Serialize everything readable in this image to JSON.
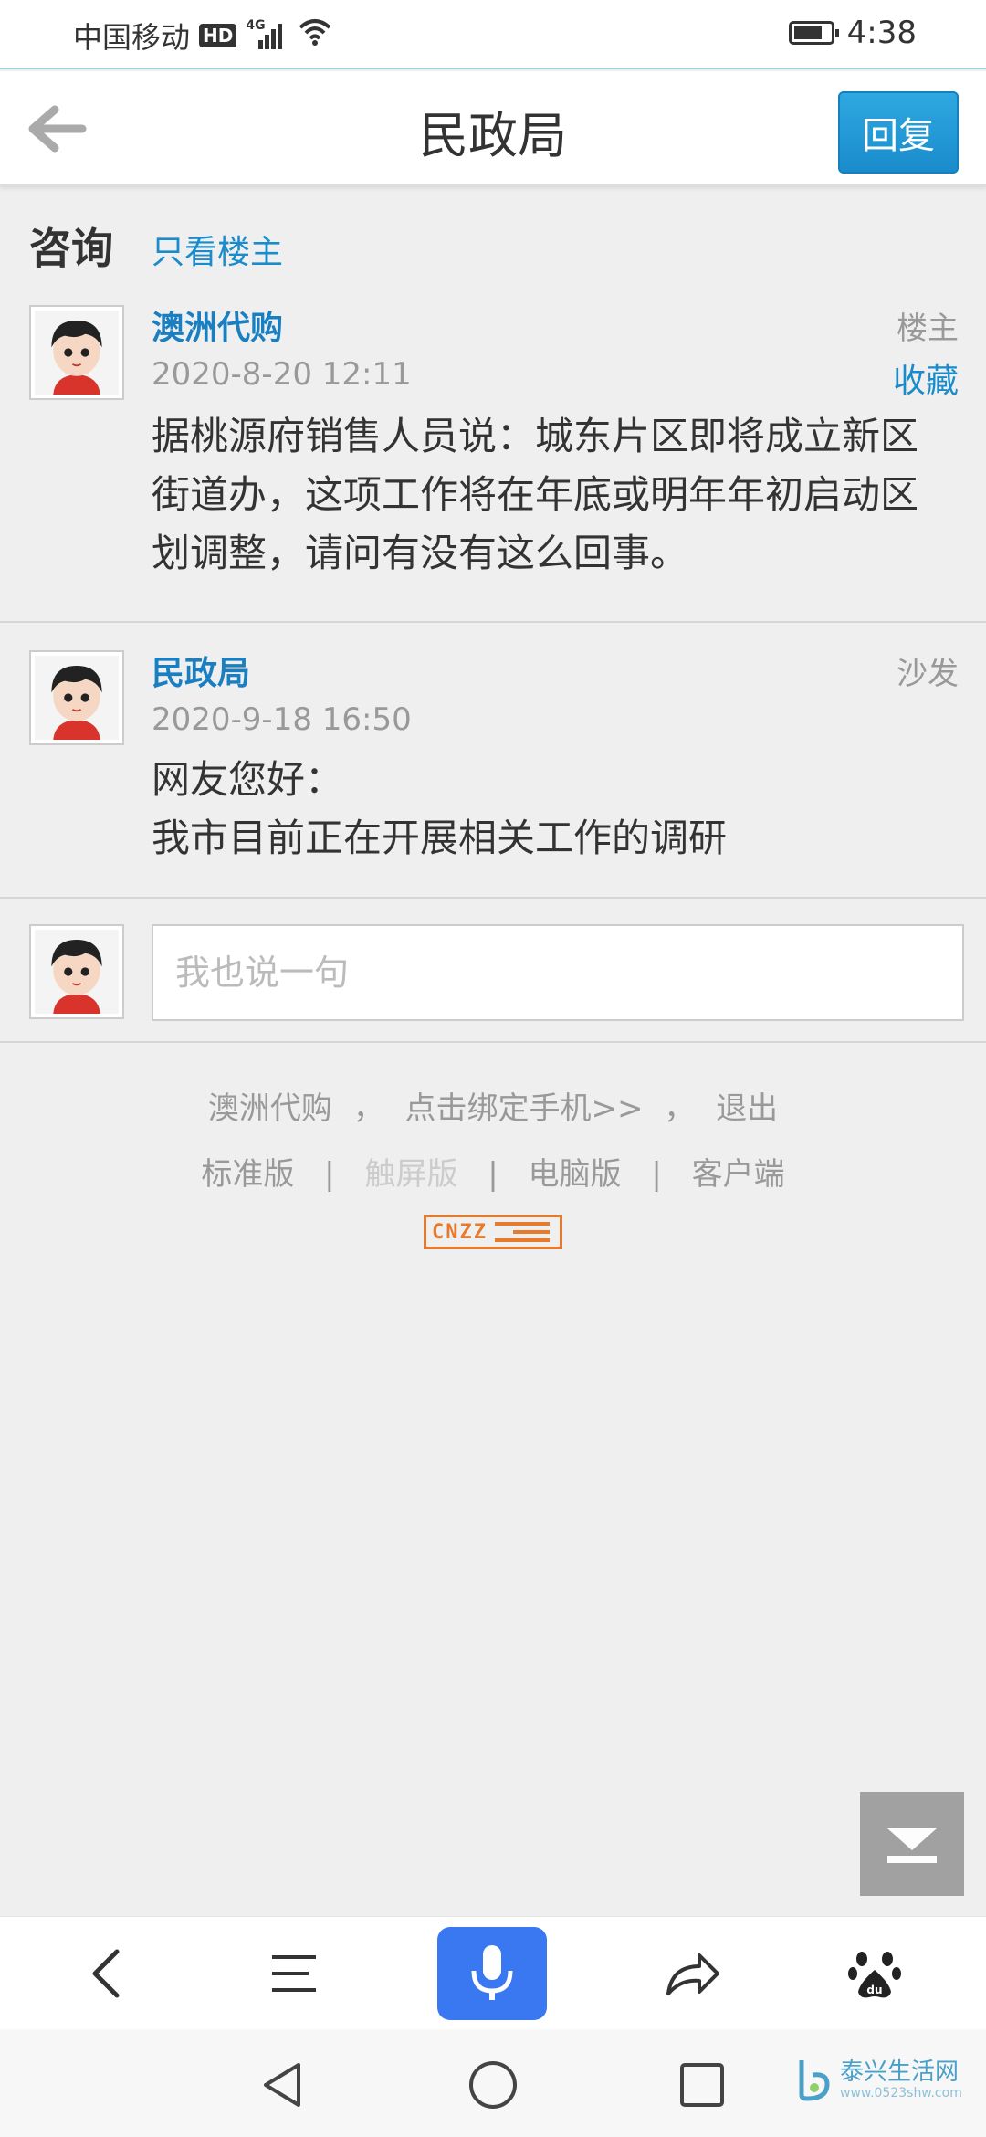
{
  "status_bar": {
    "carrier": "中国移动",
    "hd": "HD",
    "network": "4G",
    "time": "4:38"
  },
  "header": {
    "title": "民政局",
    "reply_label": "回复"
  },
  "section": {
    "title": "咨询",
    "only_op_label": "只看楼主"
  },
  "posts": [
    {
      "author": "澳洲代购",
      "time": "2020-8-20 12:11",
      "floor": "楼主",
      "favorite": "收藏",
      "body": "据桃源府销售人员说：城东片区即将成立新区街道办，这项工作将在年底或明年年初启动区划调整，请问有没有这么回事。"
    },
    {
      "author": "民政局",
      "time": "2020-9-18 16:50",
      "floor": "沙发",
      "body_line1": "网友您好：",
      "body_line2": "我市目前正在开展相关工作的调研"
    }
  ],
  "comment": {
    "placeholder": "我也说一句"
  },
  "footer": {
    "user": "澳洲代购",
    "comma1": "，",
    "bind_phone": "点击绑定手机>>",
    "comma2": "，",
    "logout": "退出",
    "standard": "标准版",
    "sep1": "|",
    "touch": "触屏版",
    "sep2": "|",
    "desktop": "电脑版",
    "sep3": "|",
    "client": "客户端",
    "cnzz": "CNZZ"
  },
  "toolbar": {
    "icons": [
      "back-icon",
      "menu-icon",
      "microphone-icon",
      "share-icon",
      "baidu-paw-icon"
    ]
  },
  "watermark": {
    "name": "泰兴生活网",
    "url": "www.0523shw.com"
  },
  "colors": {
    "accent": "#1a8ccc",
    "mic": "#3a78f2",
    "cnzz": "#e87a2c"
  }
}
